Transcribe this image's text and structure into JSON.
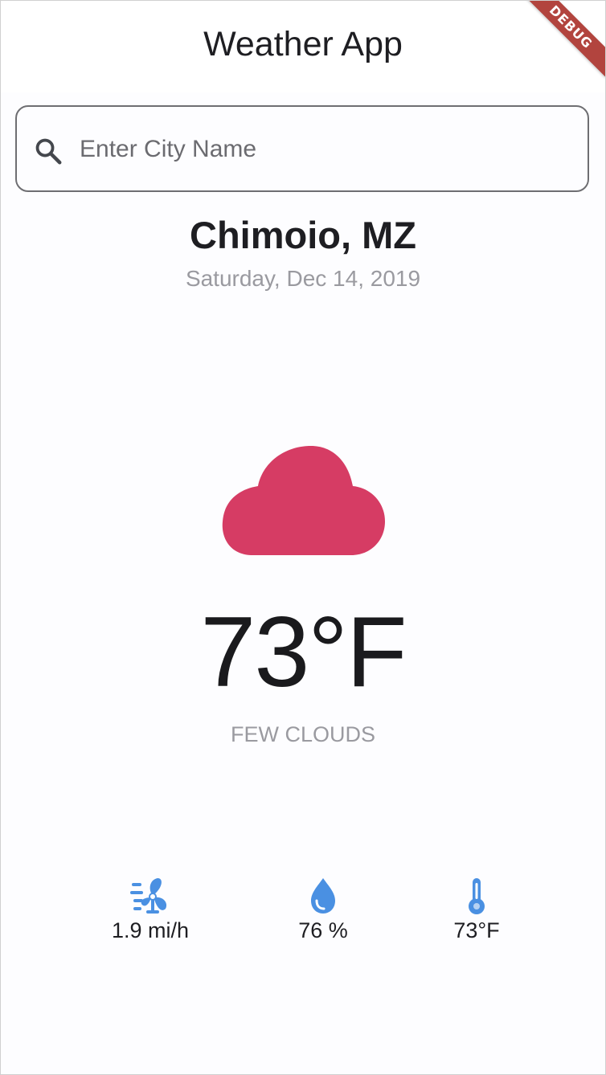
{
  "app_bar": {
    "title": "Weather App",
    "debug_banner": "DEBUG"
  },
  "search": {
    "placeholder": "Enter City Name",
    "icon": "search-icon"
  },
  "location": {
    "city": "Chimoio, MZ",
    "date": "Saturday, Dec 14, 2019"
  },
  "weather": {
    "icon": "cloud-icon",
    "icon_color": "#d63c64",
    "temperature": "73°F",
    "condition": "FEW CLOUDS"
  },
  "stats": {
    "accent_color": "#4a90e2",
    "wind": {
      "icon": "wind-fan-icon",
      "value": "1.9 mi/h"
    },
    "humidity": {
      "icon": "water-drop-icon",
      "value": "76 %"
    },
    "feels_like": {
      "icon": "thermometer-icon",
      "value": "73°F"
    }
  }
}
